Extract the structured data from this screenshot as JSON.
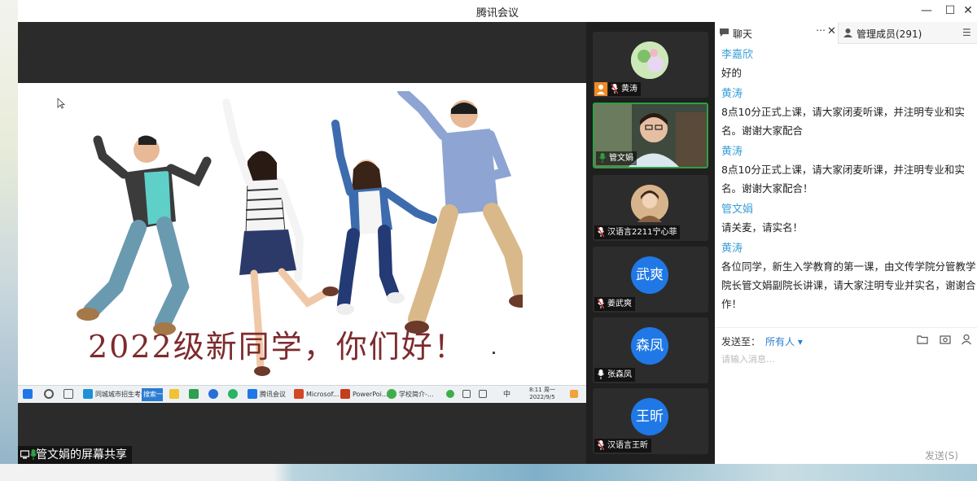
{
  "window": {
    "title": "腾讯会议",
    "controls": [
      "—",
      "☐",
      "✕"
    ]
  },
  "share": {
    "label": "管文娟的屏幕共享",
    "slide": {
      "headline": "2022级新同学，你们好！"
    },
    "taskbar": {
      "items": [
        "同城城市招生考试",
        "搜索一下",
        "腾讯会议",
        "Microsof...",
        "PowerPoi...",
        "学校简介-..."
      ],
      "tray": [
        "中"
      ],
      "clock": {
        "time": "8:11 周一",
        "date": "2022/9/5"
      }
    }
  },
  "participants": [
    {
      "name": "黄涛",
      "avatar_type": "photo",
      "avatar_color": "#a8d58a"
    },
    {
      "name": "管文娟",
      "avatar_type": "video",
      "active": true
    },
    {
      "name": "汉语言2211宁心菲",
      "avatar_type": "photo",
      "avatar_color": "#c89a6a"
    },
    {
      "name": "姜武爽",
      "avatar_type": "text",
      "avatar_text": "武爽",
      "avatar_color": "#1f78e6"
    },
    {
      "name": "张森凤",
      "avatar_type": "text",
      "avatar_text": "森凤",
      "avatar_color": "#1f78e6"
    },
    {
      "name": "汉语言王昕",
      "avatar_type": "text",
      "avatar_text": "王昕",
      "avatar_color": "#1f78e6"
    }
  ],
  "chat": {
    "tab_chat": "聊天",
    "tab_members": "管理成员(291)",
    "messages": [
      {
        "sender": "李嘉欣",
        "text": "好的"
      },
      {
        "sender": "黄涛",
        "text": "8点10分正式上课，请大家闭麦听课，并注明专业和实\n名。谢谢大家配合"
      },
      {
        "sender": "黄涛",
        "text": "8点10分正式上课，请大家闭麦听课，并注明专业和实\n名。谢谢大家配合！"
      },
      {
        "sender": "管文娟",
        "text": "请关麦，请实名！"
      },
      {
        "sender": "黄涛",
        "text": "各位同学，新生入学教育的第一课，由文传学院分管教学\n院长管文娟副院长讲课，请大家注明专业并实名，谢谢合\n作！"
      }
    ],
    "send_to_label": "发送至：",
    "send_to_value": "所有人 ▾",
    "input_placeholder": "请输入消息...",
    "send_button": "发送(S)"
  },
  "colors": {
    "accent": "#2b7cd3",
    "sender": "#3aa0d8",
    "speaking": "#2ea043",
    "avatar_blue": "#1f78e6"
  }
}
